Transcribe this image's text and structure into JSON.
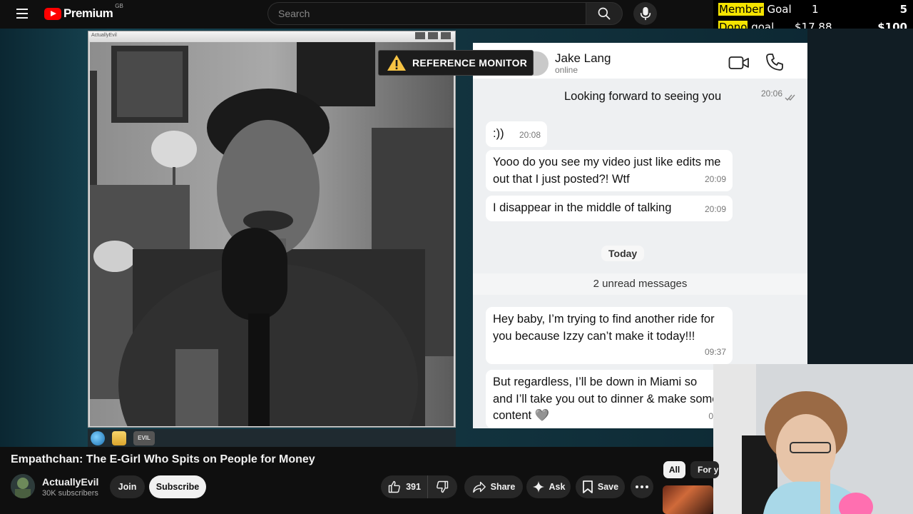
{
  "header": {
    "logo_text": "Premium",
    "logo_region": "GB",
    "search": {
      "placeholder": "Search",
      "value": ""
    }
  },
  "overlay_goals": {
    "member": {
      "label_highlight": "Member",
      "label_rest": " Goal",
      "current": "1",
      "target": "5"
    },
    "dono": {
      "label_highlight": "Dono",
      "label_rest": " goal",
      "current": "$17.88",
      "target": "$100"
    }
  },
  "webcam_window": {
    "title": "ActuallyEvil"
  },
  "reference_monitor": {
    "label": "REFERENCE MONITOR"
  },
  "chat": {
    "contact_name": "Jake Lang",
    "contact_status": "online",
    "messages": [
      {
        "text": "Looking forward to seeing you",
        "time": "20:06"
      },
      {
        "text": ":))",
        "time": "20:08"
      },
      {
        "text": "Yooo do you see my video just like edits me out that I just posted?! Wtf",
        "time": "20:09"
      },
      {
        "text": "I disappear in the middle of talking",
        "time": "20:09"
      },
      {
        "text": "Hey baby, I’m trying to find another ride for you because Izzy can’t make it today!!!",
        "time": "09:37"
      },
      {
        "text": "But regardless, I’ll be down in Miami so and I’ll take you out to dinner & make some content 🩶",
        "time": "0"
      }
    ],
    "day_label": "Today",
    "unread_label": "2 unread messages"
  },
  "taskbar": {
    "evil_label": "EVIL"
  },
  "video_info": {
    "title": "Empathchan: The E-Girl Who Spits on People for Money",
    "channel_name": "ActuallyEvil",
    "subscribers": "30K subscribers",
    "join_label": "Join",
    "subscribe_label": "Subscribe",
    "like_count": "391",
    "share_label": "Share",
    "ask_label": "Ask",
    "save_label": "Save"
  },
  "sidebar_chips": {
    "all": "All",
    "for_you": "For y"
  },
  "icons": [
    "menu-icon",
    "youtube-logo-icon",
    "search-icon",
    "mic-icon",
    "warning-icon",
    "video-call-icon",
    "phone-icon",
    "like-icon",
    "dislike-icon",
    "share-icon",
    "ask-sparkle-icon",
    "save-icon",
    "more-icon"
  ],
  "colors": {
    "background": "#0f0f0f",
    "brand_red": "#ff0000",
    "goal_highlight": "#f5e400",
    "subscribe_bg": "#f1f1f1"
  }
}
